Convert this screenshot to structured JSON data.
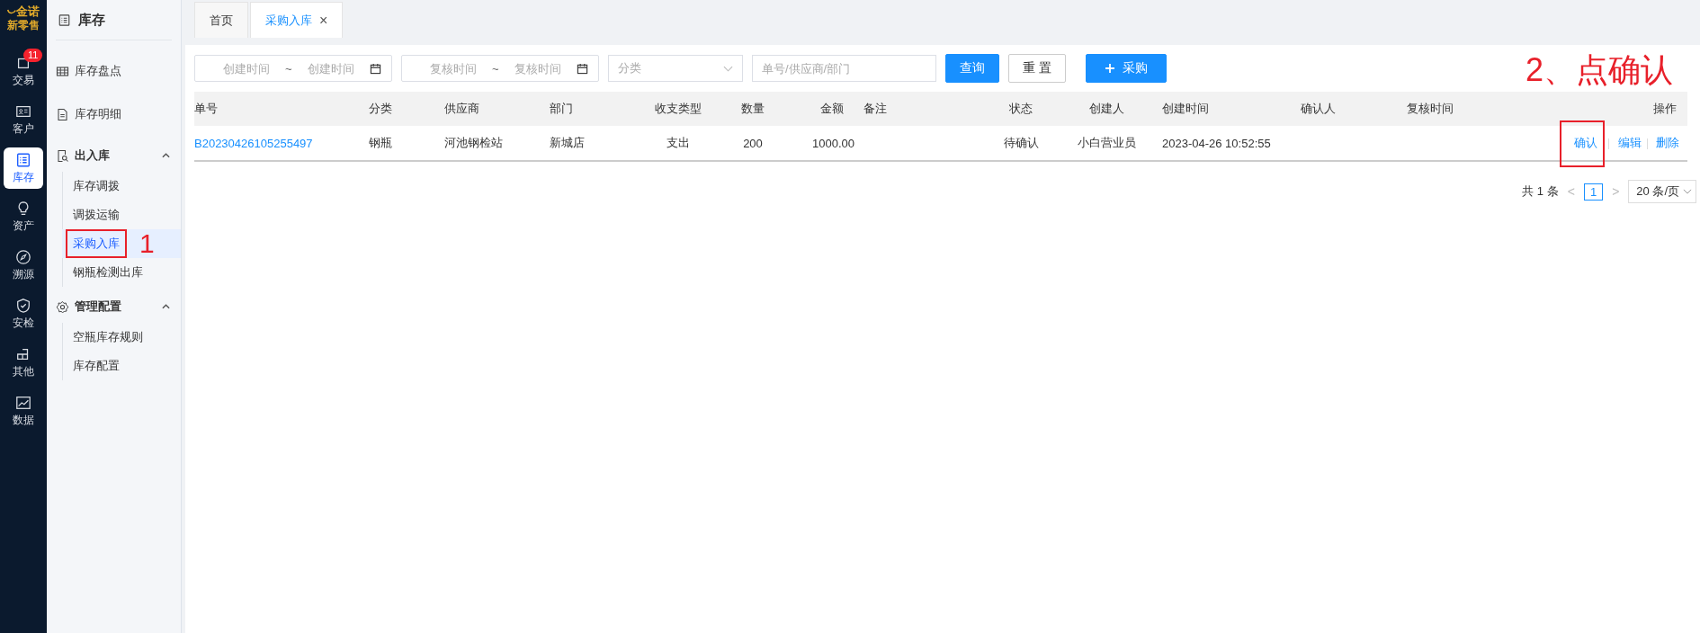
{
  "logo": {
    "brand": "金诺",
    "subtitle": "新零售"
  },
  "rail": [
    {
      "label": "交易",
      "badge": "11",
      "selected": false
    },
    {
      "label": "客户",
      "selected": false
    },
    {
      "label": "库存",
      "selected": true
    },
    {
      "label": "资产",
      "selected": false
    },
    {
      "label": "溯源",
      "selected": false
    },
    {
      "label": "安检",
      "selected": false
    },
    {
      "label": "其他",
      "selected": false
    },
    {
      "label": "数据",
      "selected": false
    }
  ],
  "sidebar": {
    "title": "库存",
    "items": [
      {
        "label": "库存盘点"
      },
      {
        "label": "库存明细"
      },
      {
        "label": "出入库",
        "expanded": true,
        "children": [
          {
            "label": "库存调拨",
            "selected": false
          },
          {
            "label": "调拨运输",
            "selected": false
          },
          {
            "label": "采购入库",
            "selected": true,
            "highlighted": true
          },
          {
            "label": "钢瓶检测出库",
            "selected": false
          }
        ]
      },
      {
        "label": "管理配置",
        "expanded": true,
        "children": [
          {
            "label": "空瓶库存规则",
            "selected": false
          },
          {
            "label": "库存配置",
            "selected": false
          }
        ]
      }
    ]
  },
  "tabs": [
    {
      "label": "首页",
      "selected": false
    },
    {
      "label": "采购入库",
      "selected": true,
      "close": "×"
    }
  ],
  "filters": {
    "created_range": {
      "start_placeholder": "创建时间",
      "end_placeholder": "创建时间",
      "separator": "~"
    },
    "review_range": {
      "start_placeholder": "复核时间",
      "end_placeholder": "复核时间",
      "separator": "~"
    },
    "category": {
      "placeholder": "分类"
    },
    "keyword": {
      "placeholder": "单号/供应商/部门"
    },
    "buttons": [
      {
        "label": "查询",
        "kind": "primary"
      },
      {
        "label": "重 置",
        "kind": "default"
      },
      {
        "label": "采购",
        "kind": "add"
      }
    ]
  },
  "table": {
    "columns": [
      "单号",
      "分类",
      "供应商",
      "部门",
      "收支类型",
      "数量",
      "金额",
      "备注",
      "状态",
      "创建人",
      "创建时间",
      "确认人",
      "复核时间",
      "操作"
    ],
    "rows": [
      {
        "cells": [
          "B20230426105255497",
          "钢瓶",
          "河池钢检站",
          "新城店",
          "支出",
          "200",
          "1000.00",
          "",
          "待确认",
          "小白营业员",
          "2023-04-26 10:52:55",
          "",
          ""
        ],
        "actions": [
          {
            "label": "确认",
            "highlighted": true
          },
          {
            "label": "编辑"
          },
          {
            "label": "删除"
          }
        ]
      }
    ]
  },
  "pagination": {
    "total": "共 1 条",
    "prev": "<",
    "pages": [
      {
        "label": "1",
        "selected": true
      }
    ],
    "next": ">",
    "page_size": "20 条/页"
  },
  "annotations": {
    "step_1": "1",
    "step_2": "2、点确认"
  }
}
